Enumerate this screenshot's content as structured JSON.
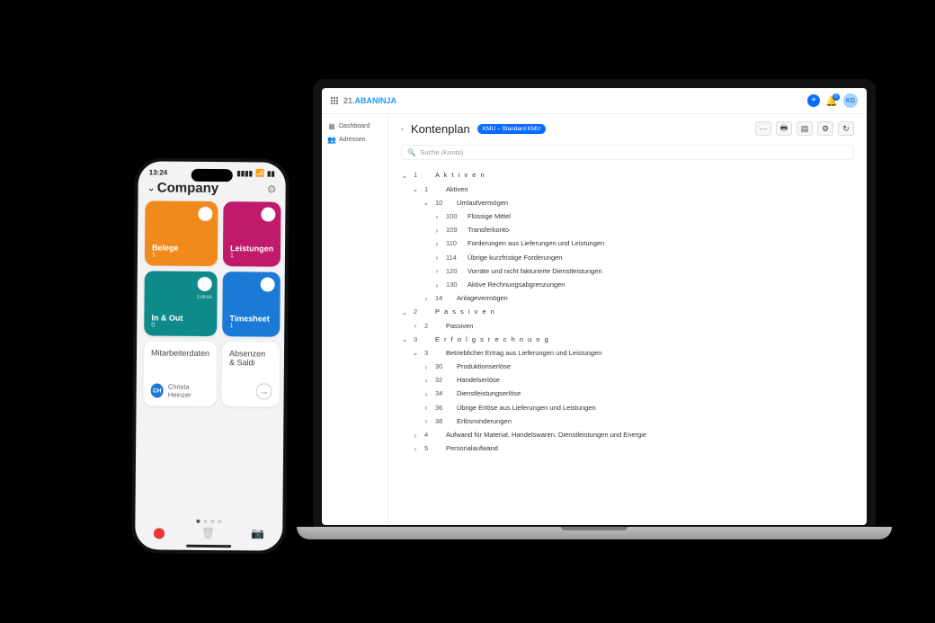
{
  "laptop": {
    "brand_prefix": "21.",
    "brand_name": "ABANINJA",
    "notification_count": "0",
    "avatar_initials": "KG",
    "sidebar": {
      "items": [
        {
          "icon": "▦",
          "label": "Dashboard"
        },
        {
          "icon": "👥",
          "label": "Adressen"
        }
      ]
    },
    "page": {
      "title": "Kontenplan",
      "chip": "KMU – Standard KMU",
      "search_placeholder": "Suche (Konto)"
    },
    "actions": {
      "more": "⋯",
      "print": "🖶",
      "table": "▤",
      "settings": "⚙",
      "refresh": "↻"
    },
    "tree": [
      {
        "depth": 0,
        "caret": "v",
        "num": "1",
        "label": "A k t i v e n",
        "spaced": true
      },
      {
        "depth": 1,
        "caret": "v",
        "num": "1",
        "label": "Aktiven"
      },
      {
        "depth": 2,
        "caret": "v",
        "num": "10",
        "label": "Umlaufvermögen"
      },
      {
        "depth": 3,
        "caret": ">",
        "num": "100",
        "label": "Flüssige Mittel"
      },
      {
        "depth": 3,
        "caret": ">",
        "num": "109",
        "label": "Transferkonto"
      },
      {
        "depth": 3,
        "caret": ">",
        "num": "110",
        "label": "Forderungen aus Lieferungen und Leistungen"
      },
      {
        "depth": 3,
        "caret": ">",
        "num": "114",
        "label": "Übrige kurzfristige Forderungen"
      },
      {
        "depth": 3,
        "caret": ">",
        "num": "120",
        "label": "Vorräte und nicht fakturierte Dienstleistungen"
      },
      {
        "depth": 3,
        "caret": ">",
        "num": "130",
        "label": "Aktive Rechnungsabgrenzungen"
      },
      {
        "depth": 2,
        "caret": ">",
        "num": "14",
        "label": "Anlagevermögen"
      },
      {
        "depth": 0,
        "caret": "v",
        "num": "2",
        "label": "P a s s i v e n",
        "spaced": true
      },
      {
        "depth": 1,
        "caret": ">",
        "num": "2",
        "label": "Passiven"
      },
      {
        "depth": 0,
        "caret": "v",
        "num": "3",
        "label": "E r f o l g s r e c h n u n g",
        "spaced": true
      },
      {
        "depth": 1,
        "caret": "v",
        "num": "3",
        "label": "Betrieblicher Ertrag aus Lieferungen und Leistungen"
      },
      {
        "depth": 2,
        "caret": ">",
        "num": "30",
        "label": "Produktionserlöse"
      },
      {
        "depth": 2,
        "caret": ">",
        "num": "32",
        "label": "Handelserlöse"
      },
      {
        "depth": 2,
        "caret": ">",
        "num": "34",
        "label": "Dienstleistungserlöse"
      },
      {
        "depth": 2,
        "caret": ">",
        "num": "36",
        "label": "Übrige Erlöse aus Lieferungen und Leistungen"
      },
      {
        "depth": 2,
        "caret": ">",
        "num": "38",
        "label": "Erlösminderungen"
      },
      {
        "depth": 1,
        "caret": ">",
        "num": "4",
        "label": "Aufwand für Material, Handelswaren, Dienstleistungen und Energie"
      },
      {
        "depth": 1,
        "caret": ">",
        "num": "5",
        "label": "Personalaufwand"
      }
    ]
  },
  "phone": {
    "status_time": "13:24",
    "title": "Company",
    "tiles": [
      {
        "style": "orange",
        "name": "Belege",
        "count": "1",
        "corner": "+"
      },
      {
        "style": "magenta",
        "name": "Leistungen",
        "count": "1",
        "corner": "+"
      },
      {
        "style": "teal",
        "name": "In & Out",
        "count": "0",
        "corner": "◉",
        "corner_time": "2:08:56"
      },
      {
        "style": "blue",
        "name": "Timesheet",
        "count": "1",
        "corner": "▶"
      }
    ],
    "white_tiles": [
      {
        "name": "Mitarbeiterdaten",
        "user_initials": "CH",
        "user_name": "Christa Heinzer"
      },
      {
        "name": "Absenzen & Saldi",
        "arrow": "→"
      }
    ]
  }
}
